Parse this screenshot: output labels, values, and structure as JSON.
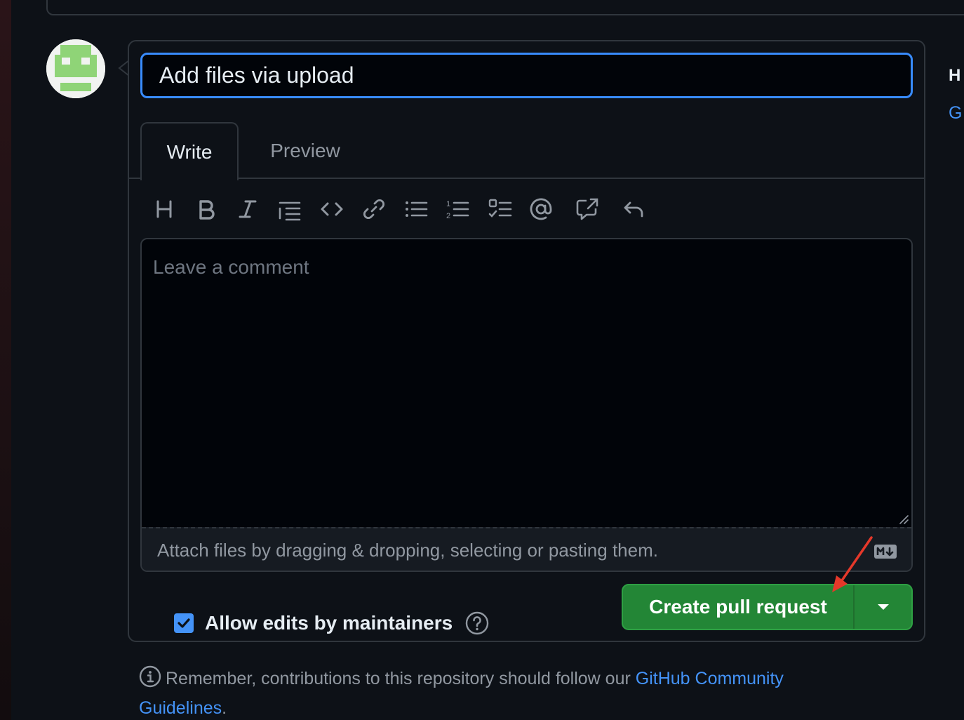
{
  "pr_form": {
    "title_value": "Add files via upload",
    "tabs": [
      {
        "label": "Write",
        "active": true
      },
      {
        "label": "Preview",
        "active": false
      }
    ],
    "toolbar": [
      {
        "name": "heading-icon"
      },
      {
        "name": "bold-icon"
      },
      {
        "name": "italic-icon"
      },
      {
        "name": "quote-icon"
      },
      {
        "name": "code-icon"
      },
      {
        "name": "link-icon"
      },
      {
        "name": "unordered-list-icon"
      },
      {
        "name": "ordered-list-icon"
      },
      {
        "name": "task-list-icon"
      },
      {
        "name": "mention-icon"
      },
      {
        "name": "cross-reference-icon"
      },
      {
        "name": "reply-icon"
      }
    ],
    "comment_placeholder": "Leave a comment",
    "attach_hint": "Attach files by dragging & dropping, selecting or pasting them.",
    "allow_edits_label": "Allow edits by maintainers",
    "allow_edits_checked": true,
    "create_button_label": "Create pull request"
  },
  "note": {
    "text": "Remember, contributions to this repository should follow our ",
    "link_part1": "GitHub Community",
    "link_part2": "Guidelines",
    "suffix": "."
  },
  "sidebar_partial": {
    "heading_letter": "H",
    "link_letter": "G"
  },
  "colors": {
    "background": "#0d1117",
    "accent_blue": "#388bfd",
    "link_blue": "#4493f8",
    "button_green": "#238636",
    "annotation_red": "#e5382a"
  }
}
